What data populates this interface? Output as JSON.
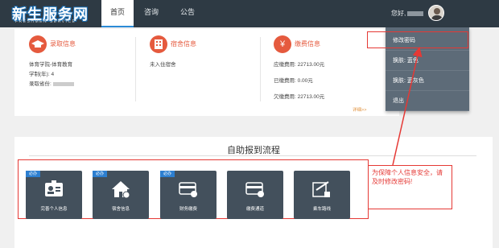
{
  "logo": {
    "main": "新生服务网",
    "sub": "FRESHMEN SERVICE"
  },
  "nav": {
    "tabs": [
      {
        "label": "首页"
      },
      {
        "label": "咨询"
      },
      {
        "label": "公告"
      }
    ]
  },
  "user": {
    "greeting": "您好,"
  },
  "info": {
    "admission": {
      "title": "录取信息",
      "college": "体育学院-体育教育",
      "years": "学制(年): 4",
      "origin_label": "录取省份:"
    },
    "dorm": {
      "title": "宿舍信息",
      "status": "未入住宿舍"
    },
    "fees": {
      "title": "缴费信息",
      "due": "应缴费用: 22713.00元",
      "paid": "已缴费用: 0.00元",
      "owed": "欠缴费用: 22713.00元",
      "detail_link": "详细>>"
    }
  },
  "menu": {
    "items": [
      {
        "label": "修改密码"
      },
      {
        "label": "换肤: 蓝色"
      },
      {
        "label": "换肤: 蓝灰色"
      },
      {
        "label": "退出"
      }
    ]
  },
  "flow": {
    "title": "自助报到流程",
    "badge": "必办",
    "steps": [
      {
        "label": "完善个人信息",
        "icon": "id-card-icon",
        "required": true
      },
      {
        "label": "宿舍信息",
        "icon": "house-icon",
        "required": true
      },
      {
        "label": "财务缴费",
        "icon": "payment-card-icon",
        "required": true
      },
      {
        "label": "缴费通道",
        "icon": "cards-icon",
        "required": false
      },
      {
        "label": "乘车路线",
        "icon": "edit-icon",
        "required": false
      }
    ]
  },
  "callout": {
    "text": "为保障个人信息安全，请及时修改密码!"
  },
  "colors": {
    "topbar": "#2e3a44",
    "accent_red": "#e55a3e",
    "annotation_red": "#e53935",
    "tile": "#43505c",
    "badge": "#2d7fd0",
    "menu": "#5d6b78"
  }
}
